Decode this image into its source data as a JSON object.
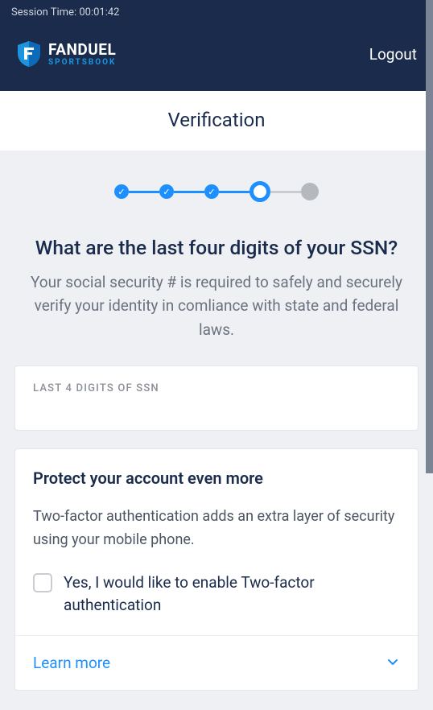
{
  "session": {
    "label": "Session Time: 00:01:42"
  },
  "brand": {
    "main": "FANDUEL",
    "sub": "SPORTSBOOK"
  },
  "header": {
    "logout": "Logout"
  },
  "page": {
    "title": "Verification"
  },
  "stepper": {
    "completed": 3,
    "current_index": 3,
    "total": 5
  },
  "form": {
    "question": "What are the last four digits of your SSN?",
    "description": "Your social security # is required to safely and securely verify your identity in comliance with state and federal laws.",
    "input_label": "LAST 4 DIGITS OF SSN",
    "input_value": ""
  },
  "protect": {
    "title": "Protect your account even more",
    "description": "Two-factor authentication adds an extra layer of security using your mobile phone.",
    "checkbox_label": "Yes, I would like to enable Two-factor authentication",
    "checked": false,
    "learn_more": "Learn more"
  }
}
